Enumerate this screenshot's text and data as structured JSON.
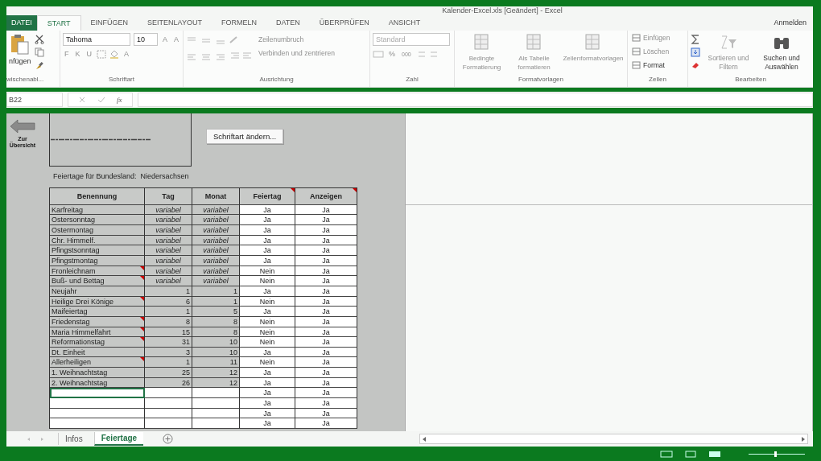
{
  "window": {
    "title": "Kalender-Excel.xls [Geändert] - Excel"
  },
  "tabs": [
    {
      "label": "DATEI",
      "kind": "file",
      "selected": false
    },
    {
      "label": "START",
      "kind": "tab",
      "selected": true
    },
    {
      "label": "EINFÜGEN",
      "kind": "tab",
      "selected": false
    },
    {
      "label": "SEITENLAYOUT",
      "kind": "tab",
      "selected": false
    },
    {
      "label": "FORMELN",
      "kind": "tab",
      "selected": false
    },
    {
      "label": "DATEN",
      "kind": "tab",
      "selected": false
    },
    {
      "label": "ÜBERPRÜFEN",
      "kind": "tab",
      "selected": false
    },
    {
      "label": "ANSICHT",
      "kind": "tab",
      "selected": false
    }
  ],
  "sign_in": "Anmelden",
  "ribbon": {
    "clipboard": {
      "label": "wischenabl...",
      "paste": "nfügen"
    },
    "font": {
      "label": "Schriftart",
      "font_name": "Tahoma",
      "font_size": "10",
      "size_buttons": [
        "A",
        "A"
      ],
      "style_buttons": [
        "F",
        "K",
        "U"
      ],
      "color_button": "A"
    },
    "alignment": {
      "label": "Ausrichtung",
      "buttons": [
        {
          "label": "Zeilenumbruch",
          "disabled": true
        },
        {
          "label": "Verbinden und zentrieren",
          "disabled": true
        }
      ]
    },
    "number": {
      "label": "Zahl",
      "format": "Standard",
      "percent": "%",
      "thousands": "000"
    },
    "styles": {
      "label": "Formatvorlagen",
      "buttons": [
        {
          "label": "Bedingte Formatierung",
          "disabled": true
        },
        {
          "label": "Als Tabelle formatieren",
          "disabled": true
        },
        {
          "label": "Zellenformatvorlagen",
          "disabled": true
        }
      ]
    },
    "cells": {
      "label": "Zellen",
      "buttons": [
        {
          "label": "Einfügen",
          "disabled": true
        },
        {
          "label": "Löschen",
          "disabled": true
        },
        {
          "label": "Format",
          "disabled": false
        }
      ]
    },
    "editing": {
      "label": "Bearbeiten",
      "buttons": [
        {
          "label": "Sortieren und Filtern",
          "disabled": true
        },
        {
          "label": "Suchen und Auswählen",
          "disabled": false
        }
      ]
    }
  },
  "formula_bar": {
    "name_box": "B22",
    "function_label": "fx"
  },
  "sheet": {
    "back_button": "Zur Übersicht",
    "font_button": "Schriftart ändern...",
    "caption": "Feiertage für Bundesland:  Niedersachsen",
    "columns": [
      {
        "label": "Benennung",
        "comment": false
      },
      {
        "label": "Tag",
        "comment": false
      },
      {
        "label": "Monat",
        "comment": false
      },
      {
        "label": "Feiertag",
        "comment": true
      },
      {
        "label": "Anzeigen",
        "comment": true
      }
    ],
    "rows": [
      {
        "kind": "variable",
        "name": "Karfreitag",
        "day": "variabel",
        "month": "variabel",
        "holiday": "Ja",
        "show": "Ja",
        "comment": false,
        "selected": false
      },
      {
        "kind": "variable",
        "name": "Ostersonntag",
        "day": "variabel",
        "month": "variabel",
        "holiday": "Ja",
        "show": "Ja",
        "comment": false,
        "selected": false
      },
      {
        "kind": "variable",
        "name": "Ostermontag",
        "day": "variabel",
        "month": "variabel",
        "holiday": "Ja",
        "show": "Ja",
        "comment": false,
        "selected": false
      },
      {
        "kind": "variable",
        "name": "Chr. Himmelf.",
        "day": "variabel",
        "month": "variabel",
        "holiday": "Ja",
        "show": "Ja",
        "comment": false,
        "selected": false
      },
      {
        "kind": "variable",
        "name": "Pfingstsonntag",
        "day": "variabel",
        "month": "variabel",
        "holiday": "Ja",
        "show": "Ja",
        "comment": false,
        "selected": false
      },
      {
        "kind": "variable",
        "name": "Pfingstmontag",
        "day": "variabel",
        "month": "variabel",
        "holiday": "Ja",
        "show": "Ja",
        "comment": false,
        "selected": false
      },
      {
        "kind": "variable",
        "name": "Fronleichnam",
        "day": "variabel",
        "month": "variabel",
        "holiday": "Nein",
        "show": "Ja",
        "comment": true,
        "selected": false
      },
      {
        "kind": "variable",
        "name": "Buß- und Bettag",
        "day": "variabel",
        "month": "variabel",
        "holiday": "Nein",
        "show": "Ja",
        "comment": true,
        "selected": false
      },
      {
        "kind": "fixed",
        "name": "Neujahr",
        "day": "1",
        "month": "1",
        "holiday": "Ja",
        "show": "Ja",
        "comment": false,
        "selected": false
      },
      {
        "kind": "fixed",
        "name": "Heilige Drei Könige",
        "day": "6",
        "month": "1",
        "holiday": "Nein",
        "show": "Ja",
        "comment": true,
        "selected": false
      },
      {
        "kind": "fixed",
        "name": "Maifeiertag",
        "day": "1",
        "month": "5",
        "holiday": "Ja",
        "show": "Ja",
        "comment": false,
        "selected": false
      },
      {
        "kind": "fixed",
        "name": "Friedenstag",
        "day": "8",
        "month": "8",
        "holiday": "Nein",
        "show": "Ja",
        "comment": true,
        "selected": false
      },
      {
        "kind": "fixed",
        "name": "Maria Himmelfahrt",
        "day": "15",
        "month": "8",
        "holiday": "Nein",
        "show": "Ja",
        "comment": true,
        "selected": false
      },
      {
        "kind": "fixed",
        "name": "Reformationstag",
        "day": "31",
        "month": "10",
        "holiday": "Nein",
        "show": "Ja",
        "comment": true,
        "selected": false
      },
      {
        "kind": "fixed",
        "name": "Dt. Einheit",
        "day": "3",
        "month": "10",
        "holiday": "Ja",
        "show": "Ja",
        "comment": false,
        "selected": false
      },
      {
        "kind": "fixed",
        "name": "Allerheiligen",
        "day": "1",
        "month": "11",
        "holiday": "Nein",
        "show": "Ja",
        "comment": true,
        "selected": false
      },
      {
        "kind": "fixed",
        "name": "1. Weihnachtstag",
        "day": "25",
        "month": "12",
        "holiday": "Ja",
        "show": "Ja",
        "comment": false,
        "selected": false
      },
      {
        "kind": "fixed",
        "name": "2. Weihnachtstag",
        "day": "26",
        "month": "12",
        "holiday": "Ja",
        "show": "Ja",
        "comment": false,
        "selected": false
      },
      {
        "kind": "empty",
        "holiday": "Ja",
        "show": "Ja",
        "comment": false,
        "selected": true
      },
      {
        "kind": "empty",
        "holiday": "Ja",
        "show": "Ja",
        "comment": false,
        "selected": false
      },
      {
        "kind": "empty",
        "holiday": "Ja",
        "show": "Ja",
        "comment": false,
        "selected": false
      },
      {
        "kind": "empty",
        "holiday": "Ja",
        "show": "Ja",
        "comment": false,
        "selected": false
      }
    ]
  },
  "sheet_tabs": [
    {
      "label": "Infos",
      "selected": false
    },
    {
      "label": "Feiertage",
      "selected": true
    }
  ],
  "status_bar": {
    "zoom": {
      "level": 0.45
    }
  }
}
